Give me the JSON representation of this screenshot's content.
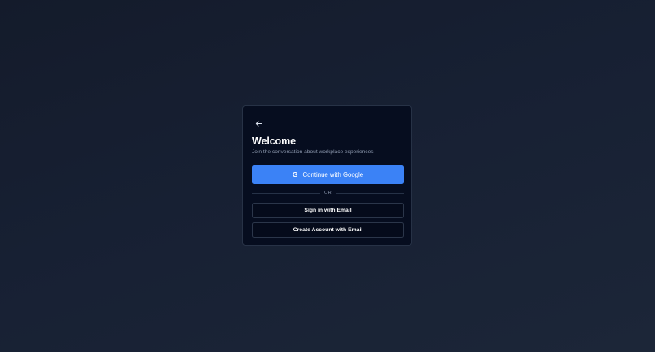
{
  "auth_card": {
    "back_icon": "arrow-left-icon",
    "title": "Welcome",
    "subtitle": "Join the conversation about workplace experiences",
    "google_button": {
      "icon": "google-icon",
      "icon_glyph": "G",
      "label": "Continue with Google"
    },
    "divider_label": "OR",
    "signin_button_label": "Sign in with Email",
    "create_account_button_label": "Create Account with Email"
  },
  "colors": {
    "background": "#172033",
    "card": "#060d1f",
    "accent": "#3b82f6",
    "text_primary": "#ffffff",
    "text_secondary": "#8e9ab0"
  }
}
